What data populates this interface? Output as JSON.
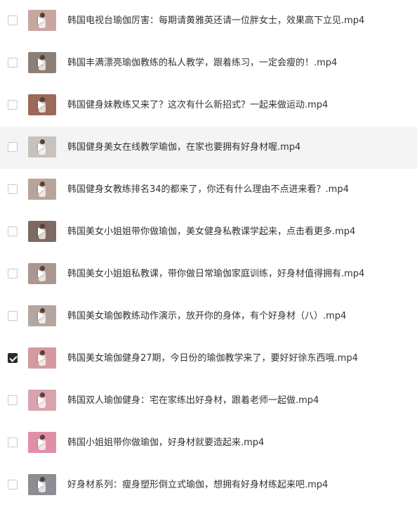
{
  "files": [
    {
      "name": "韩国电视台瑜伽厉害：每期请黄雅英还请一位胖女士，效果高下立见.mp4",
      "checked": false,
      "thumb_color": "#c9a6a0"
    },
    {
      "name": "韩国丰满漂亮瑜伽教练的私人教学，跟着练习，一定会瘦的！.mp4",
      "checked": false,
      "thumb_color": "#8c7f76"
    },
    {
      "name": "韩国健身妹教练又来了？这次有什么新招式？一起来做运动.mp4",
      "checked": false,
      "thumb_color": "#9c6a58"
    },
    {
      "name": "韩国健身美女在线教学瑜伽，在家也要拥有好身材喔.mp4",
      "checked": false,
      "thumb_color": "#c7c2bb"
    },
    {
      "name": "韩国健身女教练排名34的都来了，你还有什么理由不点进来看？.mp4",
      "checked": false,
      "thumb_color": "#b8a49a"
    },
    {
      "name": "韩国美女小姐姐带你做瑜伽，美女健身私教课学起来，点击看更多.mp4",
      "checked": false,
      "thumb_color": "#7d6a63"
    },
    {
      "name": "韩国美女小姐姐私教课，带你做日常瑜伽家庭训练，好身材值得拥有.mp4",
      "checked": false,
      "thumb_color": "#a99790"
    },
    {
      "name": "韩国美女瑜伽教练动作演示，放开你的身体，有个好身材（八）.mp4",
      "checked": false,
      "thumb_color": "#b5a79f"
    },
    {
      "name": "韩国美女瑜伽健身27期，今日份的瑜伽教学来了，要好好徐东西哦.mp4",
      "checked": true,
      "thumb_color": "#d59aa0"
    },
    {
      "name": "韩国双人瑜伽健身：宅在家练出好身材，跟着老师一起做.mp4",
      "checked": false,
      "thumb_color": "#d7a3ad"
    },
    {
      "name": "韩国小姐姐带你做瑜伽，好身材就要造起来.mp4",
      "checked": false,
      "thumb_color": "#e08fa7"
    },
    {
      "name": "好身材系列：瘦身塑形倒立式瑜伽，想拥有好身材练起来吧.mp4",
      "checked": false,
      "thumb_color": "#8d8d93"
    }
  ],
  "hover_row": 3
}
